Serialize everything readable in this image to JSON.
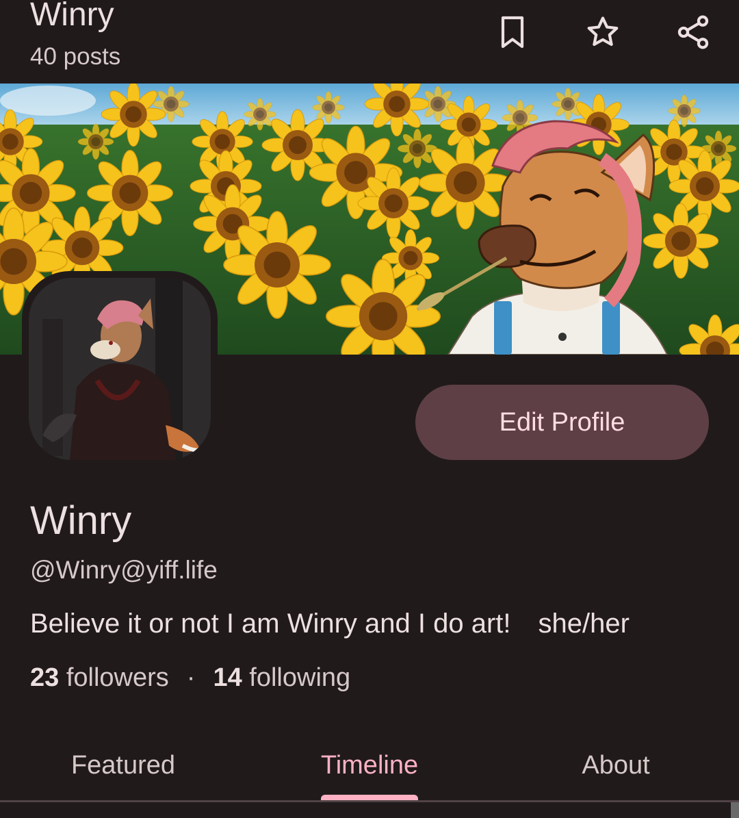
{
  "appbar": {
    "title": "Winry",
    "subtitle": "40 posts",
    "icons": [
      "bookmark-icon",
      "star-icon",
      "share-icon"
    ]
  },
  "profile": {
    "display_name": "Winry",
    "handle": "@Winry@yiff.life",
    "bio": "Believe it or not I am Winry and I do art! she/her",
    "followers_count": "23",
    "followers_label": "followers",
    "separator": "·",
    "following_count": "14",
    "following_label": "following",
    "edit_label": "Edit Profile"
  },
  "tabs": [
    {
      "label": "Featured",
      "active": false
    },
    {
      "label": "Timeline",
      "active": true
    },
    {
      "label": "About",
      "active": false
    }
  ],
  "colors": {
    "background": "#201a1b",
    "accent": "#ffb1c4",
    "edit_button": "#5e3f46",
    "edit_button_text": "#ffdde1"
  }
}
